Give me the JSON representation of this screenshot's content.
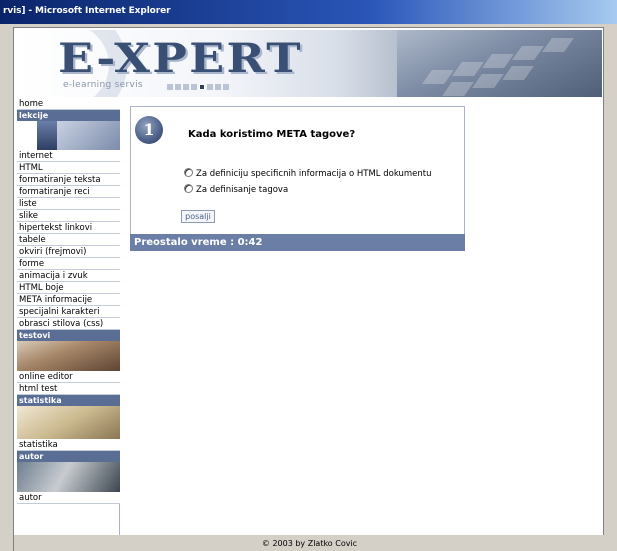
{
  "window": {
    "title": "rvis] - Microsoft Internet Explorer"
  },
  "banner": {
    "logo": "E-XPERT",
    "subtitle": "e-learning servis"
  },
  "sidebar": {
    "home": "home",
    "lekcije_header": "lekcije",
    "lekcije_items": [
      "internet",
      "HTML",
      "formatiranje teksta",
      "formatiranje reci",
      "liste",
      "slike",
      "hipertekst linkovi",
      "tabele",
      "okviri (frejmovi)",
      "forme",
      "animacija i zvuk",
      "HTML boje",
      "META informacije",
      "specijalni karakteri",
      "obrasci stilova (css)"
    ],
    "testovi_header": "testovi",
    "testovi_items": [
      "online editor",
      "html test"
    ],
    "statistika_header": "statistika",
    "statistika_items": [
      "statistika"
    ],
    "autor_header": "autor",
    "autor_items": [
      "autor"
    ]
  },
  "quiz": {
    "number": "1",
    "question": "Kada koristimo META tagove?",
    "options": [
      "Za definiciju specificnih informacija o HTML dokumentu",
      "Za definisanje tagova"
    ],
    "submit_label": "posalji",
    "timer": "Preostalo vreme : 0:42"
  },
  "footer": {
    "copyright": "© 2003 by Zlatko Covic"
  }
}
